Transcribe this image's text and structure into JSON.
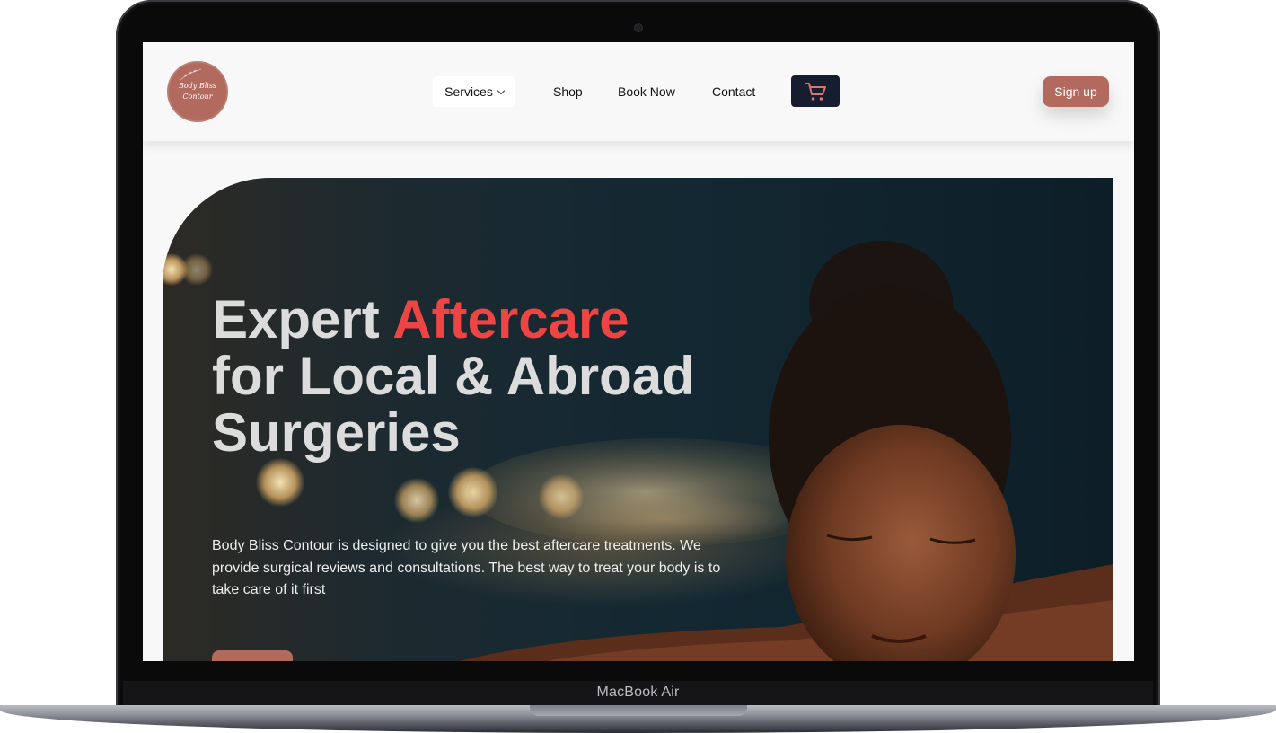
{
  "device": {
    "model_label": "MacBook Air"
  },
  "header": {
    "logo_line1": "Body Bliss",
    "logo_line2": "Contour",
    "nav": {
      "services": "Services",
      "shop": "Shop",
      "book_now": "Book Now",
      "contact": "Contact"
    },
    "cart_icon": "shopping-cart-icon",
    "signup_label": "Sign up"
  },
  "hero": {
    "title_part1": "Expert ",
    "title_accent": "Aftercare",
    "title_line2": "for Local & Abroad",
    "title_line3": "Surgeries",
    "description": "Body Bliss Contour is designed to give you the best aftercare treatments. We provide surgical reviews and consultations. The best way to treat your body is to take care of it first"
  },
  "colors": {
    "brand": "#b26a5e",
    "accent_text": "#ef4444",
    "cart_button": "#161d2e",
    "header_bg": "#f8f8f8"
  }
}
